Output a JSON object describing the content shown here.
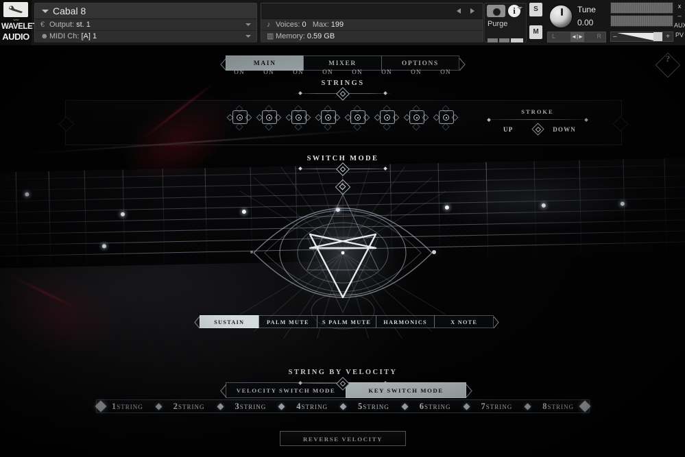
{
  "host": {
    "brand_line1": "WAVELET",
    "brand_line2": "AUDIO",
    "wrench_icon": "wrench-icon",
    "instrument_name": "Cabal 8",
    "output_label": "Output:",
    "output_value": "st. 1",
    "midi_label": "MIDI Ch:",
    "midi_value": "[A] 1",
    "voices_label": "Voices:",
    "voices_value": "0",
    "max_label": "Max:",
    "max_value": "199",
    "memory_label": "Memory:",
    "memory_value": "0.59 GB",
    "purge_label": "Purge",
    "solo_label": "S",
    "mute_label": "M",
    "tune_label": "Tune",
    "tune_value": "0.00",
    "pan_left": "L",
    "pan_right": "R",
    "vol_minus": "–",
    "vol_plus": "+",
    "camera_icon": "camera-icon",
    "info_icon": "info-icon",
    "close_label": "x",
    "minimize_label": "–",
    "aux_label": "AUX",
    "pv_label": "PV"
  },
  "tabs": [
    {
      "label": "MAIN",
      "active": true
    },
    {
      "label": "MIXER",
      "active": false
    },
    {
      "label": "OPTIONS",
      "active": false
    }
  ],
  "help": {
    "label": "?",
    "icon": "question-mark-icon"
  },
  "strings_section": {
    "title": "STRINGS",
    "buttons": [
      {
        "state": "ON"
      },
      {
        "state": "ON"
      },
      {
        "state": "ON"
      },
      {
        "state": "ON"
      },
      {
        "state": "ON"
      },
      {
        "state": "ON"
      },
      {
        "state": "ON"
      },
      {
        "state": "ON"
      }
    ]
  },
  "stroke": {
    "title": "STROKE",
    "up_label": "UP",
    "down_label": "DOWN"
  },
  "switch_mode": {
    "title": "SWITCH MODE",
    "articulations": [
      {
        "label": "SUSTAIN",
        "active": true
      },
      {
        "label": "PALM MUTE",
        "active": false
      },
      {
        "label": "S PALM MUTE",
        "active": false
      },
      {
        "label": "HARMONICS",
        "active": false
      },
      {
        "label": "X NOTE",
        "active": false
      }
    ],
    "mode_buttons": [
      {
        "label": "VELOCITY SWITCH MODE",
        "active": false
      },
      {
        "label": "KEY SWITCH MODE",
        "active": true
      }
    ]
  },
  "string_by_velocity": {
    "title": "STRING BY VELOCITY",
    "cells": [
      {
        "num": "1",
        "word": "STRING"
      },
      {
        "num": "2",
        "word": "STRING"
      },
      {
        "num": "3",
        "word": "STRING"
      },
      {
        "num": "4",
        "word": "STRING"
      },
      {
        "num": "5",
        "word": "STRING"
      },
      {
        "num": "6",
        "word": "STRING"
      },
      {
        "num": "7",
        "word": "STRING"
      },
      {
        "num": "8",
        "word": "STRING"
      }
    ],
    "reverse_label": "REVERSE VELOCITY"
  },
  "colors": {
    "accent_active": "#c8d2d2",
    "line": "#cdd5de",
    "background": "#050505",
    "red_glow": "#d1283c"
  }
}
